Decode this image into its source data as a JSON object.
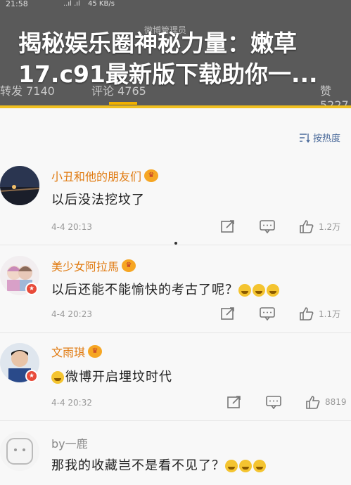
{
  "status_bar": {
    "time": "21:58",
    "signal": "..ıl .ıl",
    "speed": "45 KB/s"
  },
  "header": {
    "admin_label": "微博管理员",
    "tab_left": "转发",
    "tab_left_count": "7140",
    "tab_mid": "评论",
    "tab_mid_count": "4765",
    "tab_right": "赞",
    "tab_right_count": "5227"
  },
  "headline": {
    "line1": "揭秘娱乐圈神秘力量：嫩草",
    "line2": "17.c91最新版下载助你一..."
  },
  "sort": {
    "label": "按热度"
  },
  "comments": [
    {
      "username": "小丑和他的朋友们",
      "text": "以后没法挖坟了",
      "date": "4-4 20:13",
      "likes": "1.2万",
      "verified": false
    },
    {
      "username": "美少女阿拉馬",
      "text": "以后还能不能愉快的考古了呢？",
      "date": "4-4 20:23",
      "likes": "1.1万",
      "verified": true
    },
    {
      "username": "文雨琪",
      "text": "微博开启埋坟时代",
      "date": "4-4 20:32",
      "likes": "8819",
      "verified": true
    },
    {
      "username": "by一鹿",
      "text": "那我的收藏岂不是看不见了？",
      "date": "",
      "likes": "",
      "verified": false
    }
  ],
  "colors": {
    "accent": "#f0c020",
    "username": "#e07a10",
    "sort_link": "#4a6a9a"
  }
}
